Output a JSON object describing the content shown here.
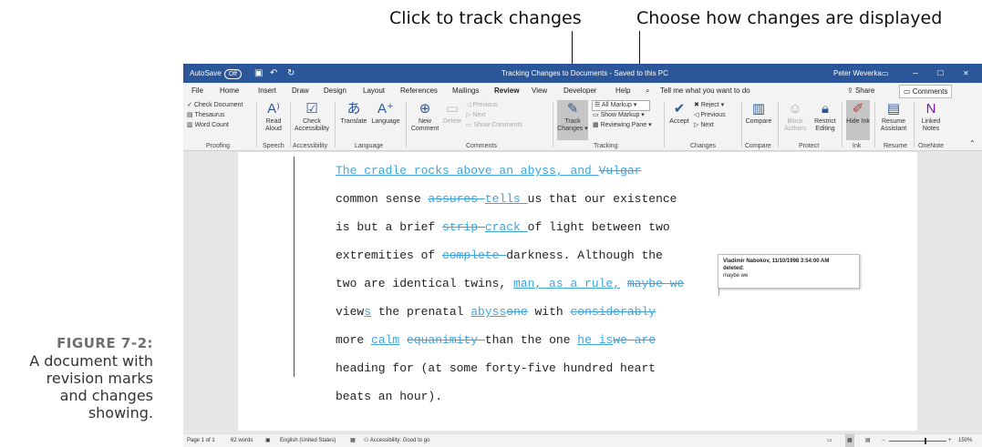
{
  "callouts": {
    "track": "Click to track changes",
    "display": "Choose how changes are displayed"
  },
  "figure": {
    "number": "FIGURE 7-2:",
    "caption_lines": [
      "A document with",
      "revision marks",
      "and changes",
      "showing."
    ]
  },
  "titlebar": {
    "autosave": "AutoSave",
    "autosave_state": "Off",
    "title": "Tracking Changes to Documents - Saved to this PC",
    "user": "Peter Weverka"
  },
  "menu": {
    "tabs": [
      "File",
      "Home",
      "Insert",
      "Draw",
      "Design",
      "Layout",
      "References",
      "Mailings",
      "Review",
      "View",
      "Developer",
      "Help"
    ],
    "tell_me": "Tell me what you want to do",
    "share": "Share",
    "comments": "Comments"
  },
  "ribbon": {
    "proofing": {
      "check_document": "Check Document",
      "thesaurus": "Thesaurus",
      "word_count": "Word Count",
      "label": "Proofing"
    },
    "speech": {
      "read_aloud": "Read Aloud",
      "label": "Speech"
    },
    "accessibility": {
      "check_accessibility": "Check Accessibility",
      "label": "Accessibility"
    },
    "language": {
      "translate": "Translate",
      "language": "Language",
      "label": "Language"
    },
    "comments": {
      "new_comment": "New Comment",
      "delete": "Delete",
      "previous": "Previous",
      "next": "Next",
      "show_comments": "Show Comments",
      "label": "Comments"
    },
    "tracking": {
      "track_changes": "Track Changes",
      "all_markup": "All Markup",
      "show_markup": "Show Markup",
      "reviewing_pane": "Reviewing Pane",
      "label": "Tracking"
    },
    "changes": {
      "accept": "Accept",
      "reject": "Reject",
      "previous": "Previous",
      "next": "Next",
      "label": "Changes"
    },
    "compare": {
      "compare": "Compare",
      "label": "Compare"
    },
    "protect": {
      "block_authors": "Block Authors",
      "restrict_editing": "Restrict Editing",
      "label": "Protect"
    },
    "ink": {
      "hide_ink": "Hide Ink",
      "label": "Ink"
    },
    "resume": {
      "resume_assistant": "Resume Assistant",
      "label": "Resume"
    },
    "onenote": {
      "linked_notes": "Linked Notes",
      "label": "OneNote"
    }
  },
  "document": {
    "lines": [
      [
        {
          "t": "The cradle rocks above an abyss, and ",
          "s": "ins"
        },
        {
          "t": "Vulgar",
          "s": "del"
        }
      ],
      [
        {
          "t": "common sense ",
          "s": ""
        },
        {
          "t": "assures ",
          "s": "del"
        },
        {
          "t": "tells ",
          "s": "ins"
        },
        {
          "t": "us that our existence",
          "s": ""
        }
      ],
      [
        {
          "t": "is but a brief ",
          "s": ""
        },
        {
          "t": "strip ",
          "s": "del"
        },
        {
          "t": " crack ",
          "s": "ins"
        },
        {
          "t": "of light between two",
          "s": ""
        }
      ],
      [
        {
          "t": "extremities of ",
          "s": ""
        },
        {
          "t": "complete ",
          "s": "del"
        },
        {
          "t": "darkness. Although the",
          "s": ""
        }
      ],
      [
        {
          "t": "two are identical twins, ",
          "s": ""
        },
        {
          "t": "man, as a rule,",
          "s": "ins"
        },
        {
          "t": " ",
          "s": ""
        },
        {
          "t": "maybe we",
          "s": "del"
        }
      ],
      [
        {
          "t": "view",
          "s": ""
        },
        {
          "t": "s",
          "s": "ins"
        },
        {
          "t": " the prenatal ",
          "s": ""
        },
        {
          "t": "abyss",
          "s": "ins"
        },
        {
          "t": "one",
          "s": "del"
        },
        {
          "t": " with ",
          "s": ""
        },
        {
          "t": "considerably",
          "s": "del"
        }
      ],
      [
        {
          "t": "more ",
          "s": ""
        },
        {
          "t": "calm",
          "s": "ins"
        },
        {
          "t": " ",
          "s": ""
        },
        {
          "t": "equanimity ",
          "s": "del"
        },
        {
          "t": "than the one ",
          "s": ""
        },
        {
          "t": "he is",
          "s": "ins"
        },
        {
          "t": "we are",
          "s": "del"
        }
      ],
      [
        {
          "t": "heading for (at some forty-five hundred heart",
          "s": ""
        }
      ],
      [
        {
          "t": "beats an hour).",
          "s": ""
        }
      ]
    ]
  },
  "comment": {
    "header": "Vladimir Nabokov, 11/10/1998 3:54:00 AM",
    "action": "deleted:",
    "text": "maybe we"
  },
  "status": {
    "page": "Page 1 of 1",
    "words": "62 words",
    "language": "English (United States)",
    "accessibility": "Accessibility: Good to go",
    "zoom": "150%"
  },
  "colors": {
    "accent": "#2b579a",
    "revision": "#3ea4e0"
  }
}
